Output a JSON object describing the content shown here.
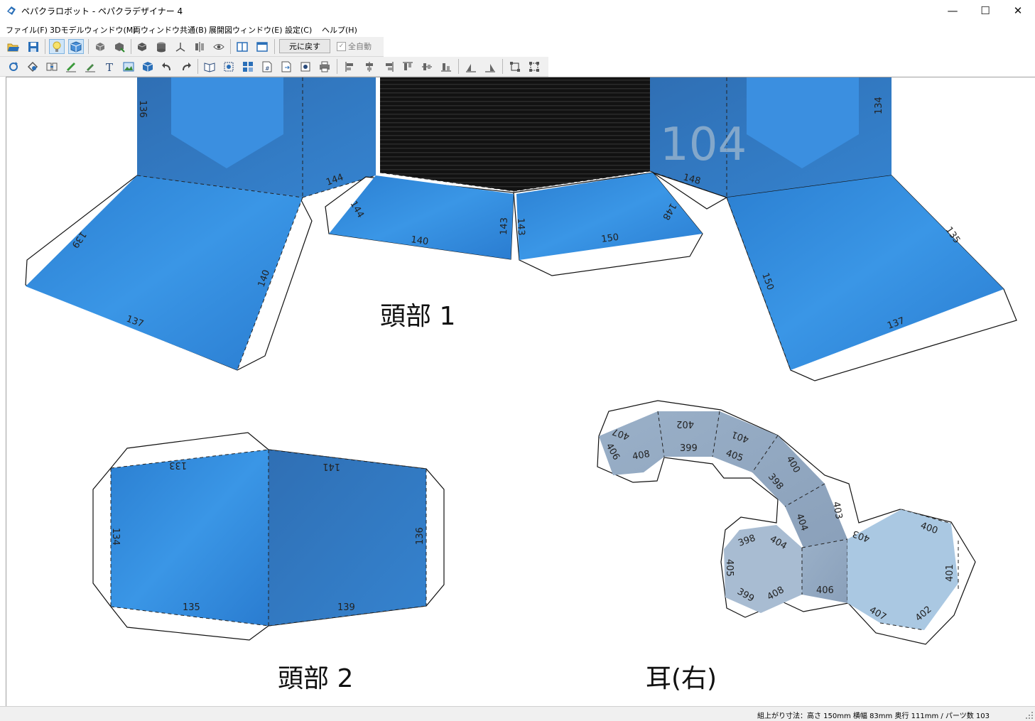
{
  "window": {
    "title": "ペパクラロボット - ペパクラデザイナー 4",
    "minimize": "—",
    "maximize": "☐",
    "close": "✕"
  },
  "menu": [
    {
      "label": "ファイル(F)"
    },
    {
      "label": "3Dモデルウィンドウ(M)"
    },
    {
      "label": "両ウィンドウ共通(B)"
    },
    {
      "label": "展開図ウィンドウ(E)"
    },
    {
      "label": "設定(C)"
    },
    {
      "label": "ヘルプ(H)"
    }
  ],
  "toolbar": {
    "undo_label": "元に戻す",
    "auto_label": "全自動",
    "auto_checked": true
  },
  "canvas": {
    "groups": [
      {
        "label": "頭部 1"
      },
      {
        "label": "頭部 2"
      },
      {
        "label": "耳(右)"
      }
    ],
    "watermark": "104",
    "edge_numbers": {
      "head1": [
        "136",
        "144",
        "144",
        "140",
        "143",
        "143",
        "150",
        "148",
        "148",
        "134",
        "139",
        "140",
        "137",
        "135",
        "150",
        "137"
      ],
      "head2": [
        "133",
        "141",
        "134",
        "136",
        "135",
        "139"
      ],
      "ear": [
        "407",
        "402",
        "401",
        "406",
        "408",
        "399",
        "405",
        "400",
        "398",
        "403",
        "404",
        "398",
        "404",
        "405",
        "399",
        "408",
        "406",
        "403",
        "400",
        "401",
        "407",
        "402"
      ]
    },
    "colors": {
      "blue_part": "#2d8ae0",
      "blue_dark": "#2a6fb8",
      "ear_gray": "#9fb2c8",
      "ear_light": "#aac8e2",
      "visor": "#1a1a1a"
    }
  },
  "status": {
    "text": "組上がり寸法：高さ 150mm 横幅 83mm 奥行 111mm / パーツ数 103"
  }
}
